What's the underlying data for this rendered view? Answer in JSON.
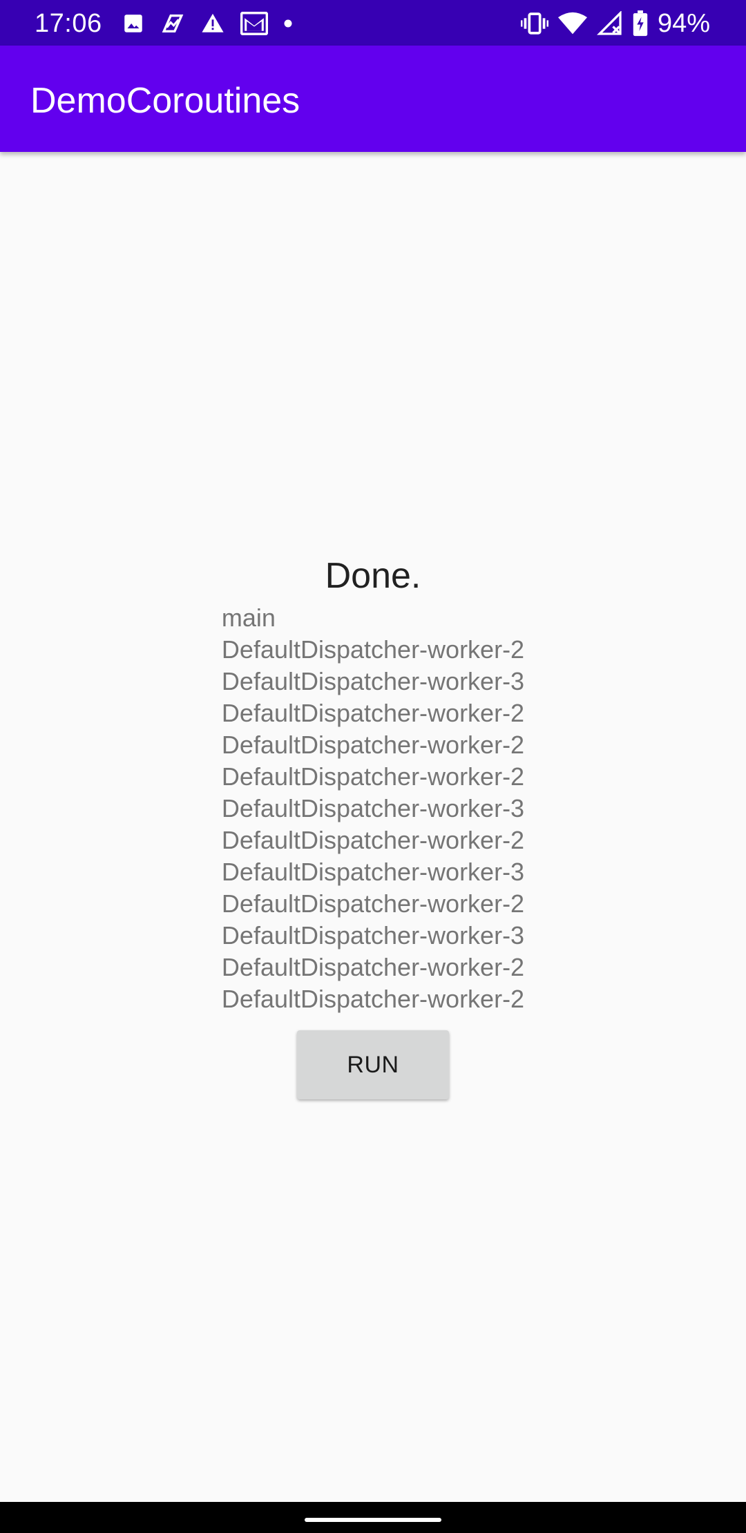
{
  "status_bar": {
    "time": "17:06",
    "battery": "94%",
    "left_icons": [
      "image-icon",
      "analytics-icon",
      "warning-icon",
      "gmail-icon",
      "dot-icon"
    ],
    "right_icons": [
      "vibrate-icon",
      "wifi-icon",
      "signal-icon",
      "battery-icon"
    ],
    "background": "#3700b3"
  },
  "app_bar": {
    "title": "DemoCoroutines",
    "background": "#6200ee"
  },
  "main": {
    "status_title": "Done.",
    "log_lines": [
      "main",
      "DefaultDispatcher-worker-2",
      "DefaultDispatcher-worker-3",
      "DefaultDispatcher-worker-2",
      "DefaultDispatcher-worker-2",
      "DefaultDispatcher-worker-2",
      "DefaultDispatcher-worker-3",
      "DefaultDispatcher-worker-2",
      "DefaultDispatcher-worker-3",
      "DefaultDispatcher-worker-2",
      "DefaultDispatcher-worker-3",
      "DefaultDispatcher-worker-2",
      "DefaultDispatcher-worker-2"
    ],
    "run_button_label": "RUN"
  }
}
